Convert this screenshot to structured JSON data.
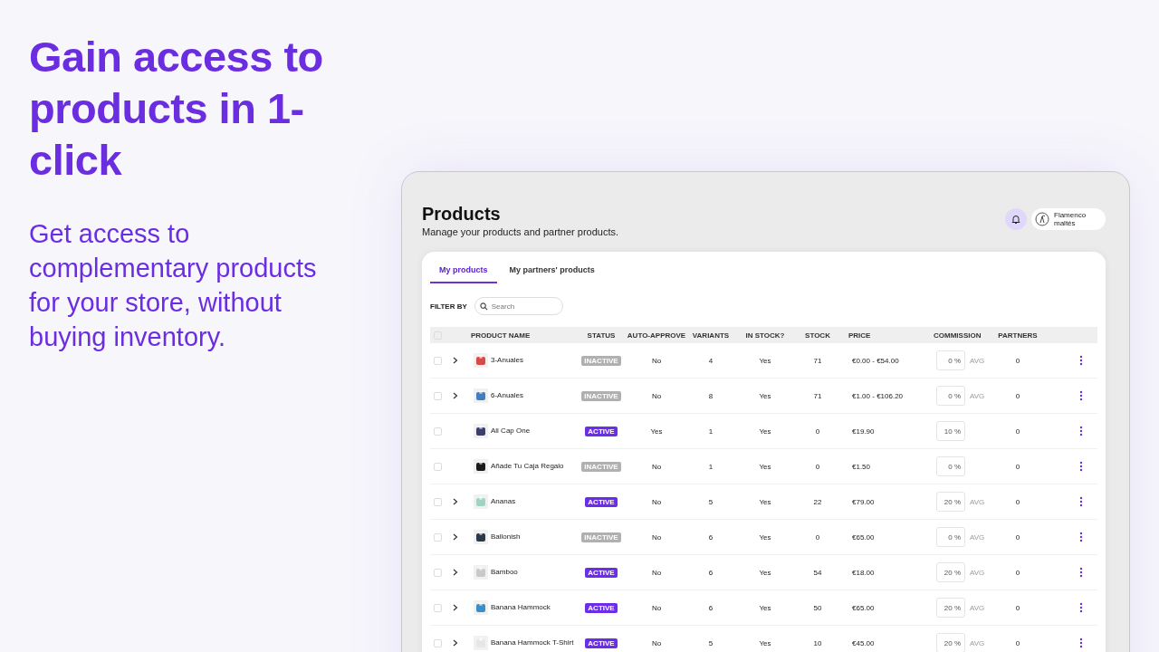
{
  "headline": "Gain access to products in 1-click",
  "subtext": "Get access to complementary products for your store, without buying inventory.",
  "page": {
    "title": "Products",
    "subtitle": "Manage your products and partner products."
  },
  "account": {
    "name": "Flamenco maltés"
  },
  "tabs": [
    {
      "label": "My products",
      "selected": true
    },
    {
      "label": "My partners' products",
      "selected": false
    }
  ],
  "filter": {
    "label": "FILTER BY",
    "placeholder": "Search"
  },
  "table": {
    "select_all_checked": false,
    "columns": [
      "PRODUCT NAME",
      "STATUS",
      "AUTO-APPROVE",
      "VARIANTS",
      "IN STOCK?",
      "STOCK",
      "PRICE",
      "COMMISSION",
      "PARTNERS"
    ],
    "rows": [
      {
        "checked": false,
        "expandable": true,
        "name": "3-Anuales",
        "status": "INACTIVE",
        "active": false,
        "auto_approve": "No",
        "variants": "4",
        "in_stock": "Yes",
        "stock": "71",
        "price": "€0.00 - €54.00",
        "commission": "0 %",
        "avg": "AVG",
        "partners": "0"
      },
      {
        "checked": false,
        "expandable": true,
        "name": "6-Anuales",
        "status": "INACTIVE",
        "active": false,
        "auto_approve": "No",
        "variants": "8",
        "in_stock": "Yes",
        "stock": "71",
        "price": "€1.00 - €106.20",
        "commission": "0 %",
        "avg": "AVG",
        "partners": "0"
      },
      {
        "checked": false,
        "expandable": false,
        "name": "All Cap One",
        "status": "ACTIVE",
        "active": true,
        "auto_approve": "Yes",
        "variants": "1",
        "in_stock": "Yes",
        "stock": "0",
        "price": "€19.90",
        "commission": "10 %",
        "partners": "0"
      },
      {
        "checked": false,
        "expandable": false,
        "name": "Añade Tu Caja Regalo",
        "status": "INACTIVE",
        "active": false,
        "auto_approve": "No",
        "variants": "1",
        "in_stock": "Yes",
        "stock": "0",
        "price": "€1.50",
        "commission": "0 %",
        "partners": "0"
      },
      {
        "checked": false,
        "expandable": true,
        "name": "Ananas",
        "status": "ACTIVE",
        "active": true,
        "auto_approve": "No",
        "variants": "5",
        "in_stock": "Yes",
        "stock": "22",
        "price": "€79.00",
        "commission": "20 %",
        "avg": "AVG",
        "partners": "0"
      },
      {
        "checked": false,
        "expandable": true,
        "name": "Ballonish",
        "status": "INACTIVE",
        "active": false,
        "auto_approve": "No",
        "variants": "6",
        "in_stock": "Yes",
        "stock": "0",
        "price": "€65.00",
        "commission": "0 %",
        "avg": "AVG",
        "partners": "0"
      },
      {
        "checked": false,
        "expandable": true,
        "name": "Bamboo",
        "status": "ACTIVE",
        "active": true,
        "auto_approve": "No",
        "variants": "6",
        "in_stock": "Yes",
        "stock": "54",
        "price": "€18.00",
        "commission": "20 %",
        "avg": "AVG",
        "partners": "0"
      },
      {
        "checked": false,
        "expandable": true,
        "name": "Banana Hammock",
        "status": "ACTIVE",
        "active": true,
        "auto_approve": "No",
        "variants": "6",
        "in_stock": "Yes",
        "stock": "50",
        "price": "€65.00",
        "commission": "20 %",
        "avg": "AVG",
        "partners": "0"
      },
      {
        "checked": false,
        "expandable": true,
        "name": "Banana Hammock T-Shirt",
        "status": "ACTIVE",
        "active": true,
        "auto_approve": "No",
        "variants": "5",
        "in_stock": "Yes",
        "stock": "10",
        "price": "€45.00",
        "commission": "20 %",
        "avg": "AVG",
        "partners": "0"
      }
    ]
  }
}
